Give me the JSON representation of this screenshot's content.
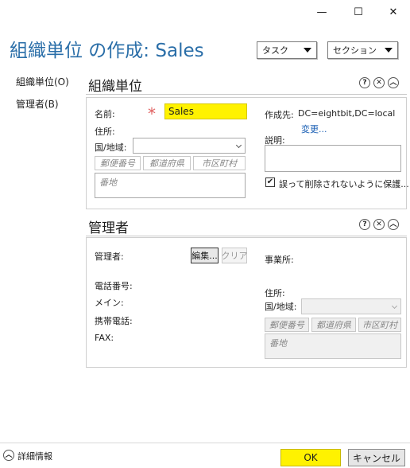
{
  "window": {
    "minimize_glyph": "—",
    "maximize_glyph": "☐",
    "close_glyph": "✕"
  },
  "header": {
    "title": "組織単位 の作成: Sales",
    "task_label": "タスク",
    "section_label": "セクション"
  },
  "sidebar": {
    "items": [
      {
        "label": "組織単位(O)"
      },
      {
        "label": "管理者(B)"
      }
    ]
  },
  "ou_section": {
    "title": "組織単位",
    "name_label": "名前:",
    "required_mark": "*",
    "name_value": "Sales",
    "address_label": "住所:",
    "country_label": "国/地域:",
    "country_value": "",
    "postal_placeholder": "郵便番号",
    "prefecture_placeholder": "都道府県",
    "city_placeholder": "市区町村",
    "street_placeholder": "番地",
    "created_in_label": "作成先:",
    "created_in_value": "DC=eightbit,DC=local",
    "change_link": "変更...",
    "description_label": "説明:",
    "protect_label": "誤って削除されないように保護...",
    "protect_checked": true
  },
  "manager_section": {
    "title": "管理者",
    "manager_label": "管理者:",
    "edit_button": "編集...",
    "clear_button": "クリア",
    "office_label": "事業所:",
    "phone_label": "電話番号:",
    "main_label": "メイン:",
    "mobile_label": "携帯電話:",
    "fax_label": "FAX:",
    "address_label": "住所:",
    "country_label": "国/地域:",
    "postal_placeholder": "郵便番号",
    "prefecture_placeholder": "都道府県",
    "city_placeholder": "市区町村",
    "street_placeholder": "番地"
  },
  "section_controls": {
    "help": "?",
    "close": "✕",
    "collapse": "︿"
  },
  "footer": {
    "details_label": "詳細情報",
    "ok_label": "OK",
    "cancel_label": "キャンセル"
  },
  "colors": {
    "title_blue": "#2a6ea8",
    "highlight_yellow": "#fff200",
    "link_blue": "#1a5fb4",
    "required_red": "#e06060"
  }
}
